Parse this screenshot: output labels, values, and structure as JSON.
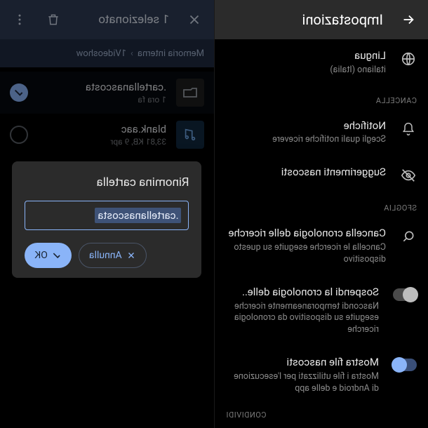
{
  "left": {
    "title": "Impostazioni",
    "lang": {
      "label": "Lingua",
      "value": "italiano (Italia)"
    },
    "sect_cancel": "CANCELLA",
    "notif": {
      "label": "Notifiche",
      "sub": "Scegli quali notifiche ricevere"
    },
    "sugg": {
      "label": "Suggerimenti nascosti"
    },
    "sect_browse": "SFOGLIA",
    "clear": {
      "label": "Cancella cronologia delle ricerche",
      "sub": "Cancella le ricerche eseguite su questo dispositivo"
    },
    "pause": {
      "label": "Sospendi la cronologia delle..",
      "sub": "Nascondi temporaneamente ricerche eseguite su dispositivo da cronologia ricerche"
    },
    "hidden": {
      "label": "Mostra file nascosti",
      "sub": "Mostra i file utilizzati per l'esecuzione di Android e delle app"
    },
    "sect_share": "CONDIVIDI"
  },
  "right": {
    "selected": "1 selezionato",
    "crumb1": "Memoria interna",
    "crumb2": "1Videoshow",
    "folder": {
      "name": ".cartellanascosta",
      "sub": "1 ora fa"
    },
    "file": {
      "name": "blank.aac",
      "sub": "33,81 KB, 9 apr"
    },
    "dialog": {
      "title": "Rinomina cartella",
      "value": ".cartellanascosta",
      "cancel": "Annulla",
      "ok": "OK"
    }
  }
}
